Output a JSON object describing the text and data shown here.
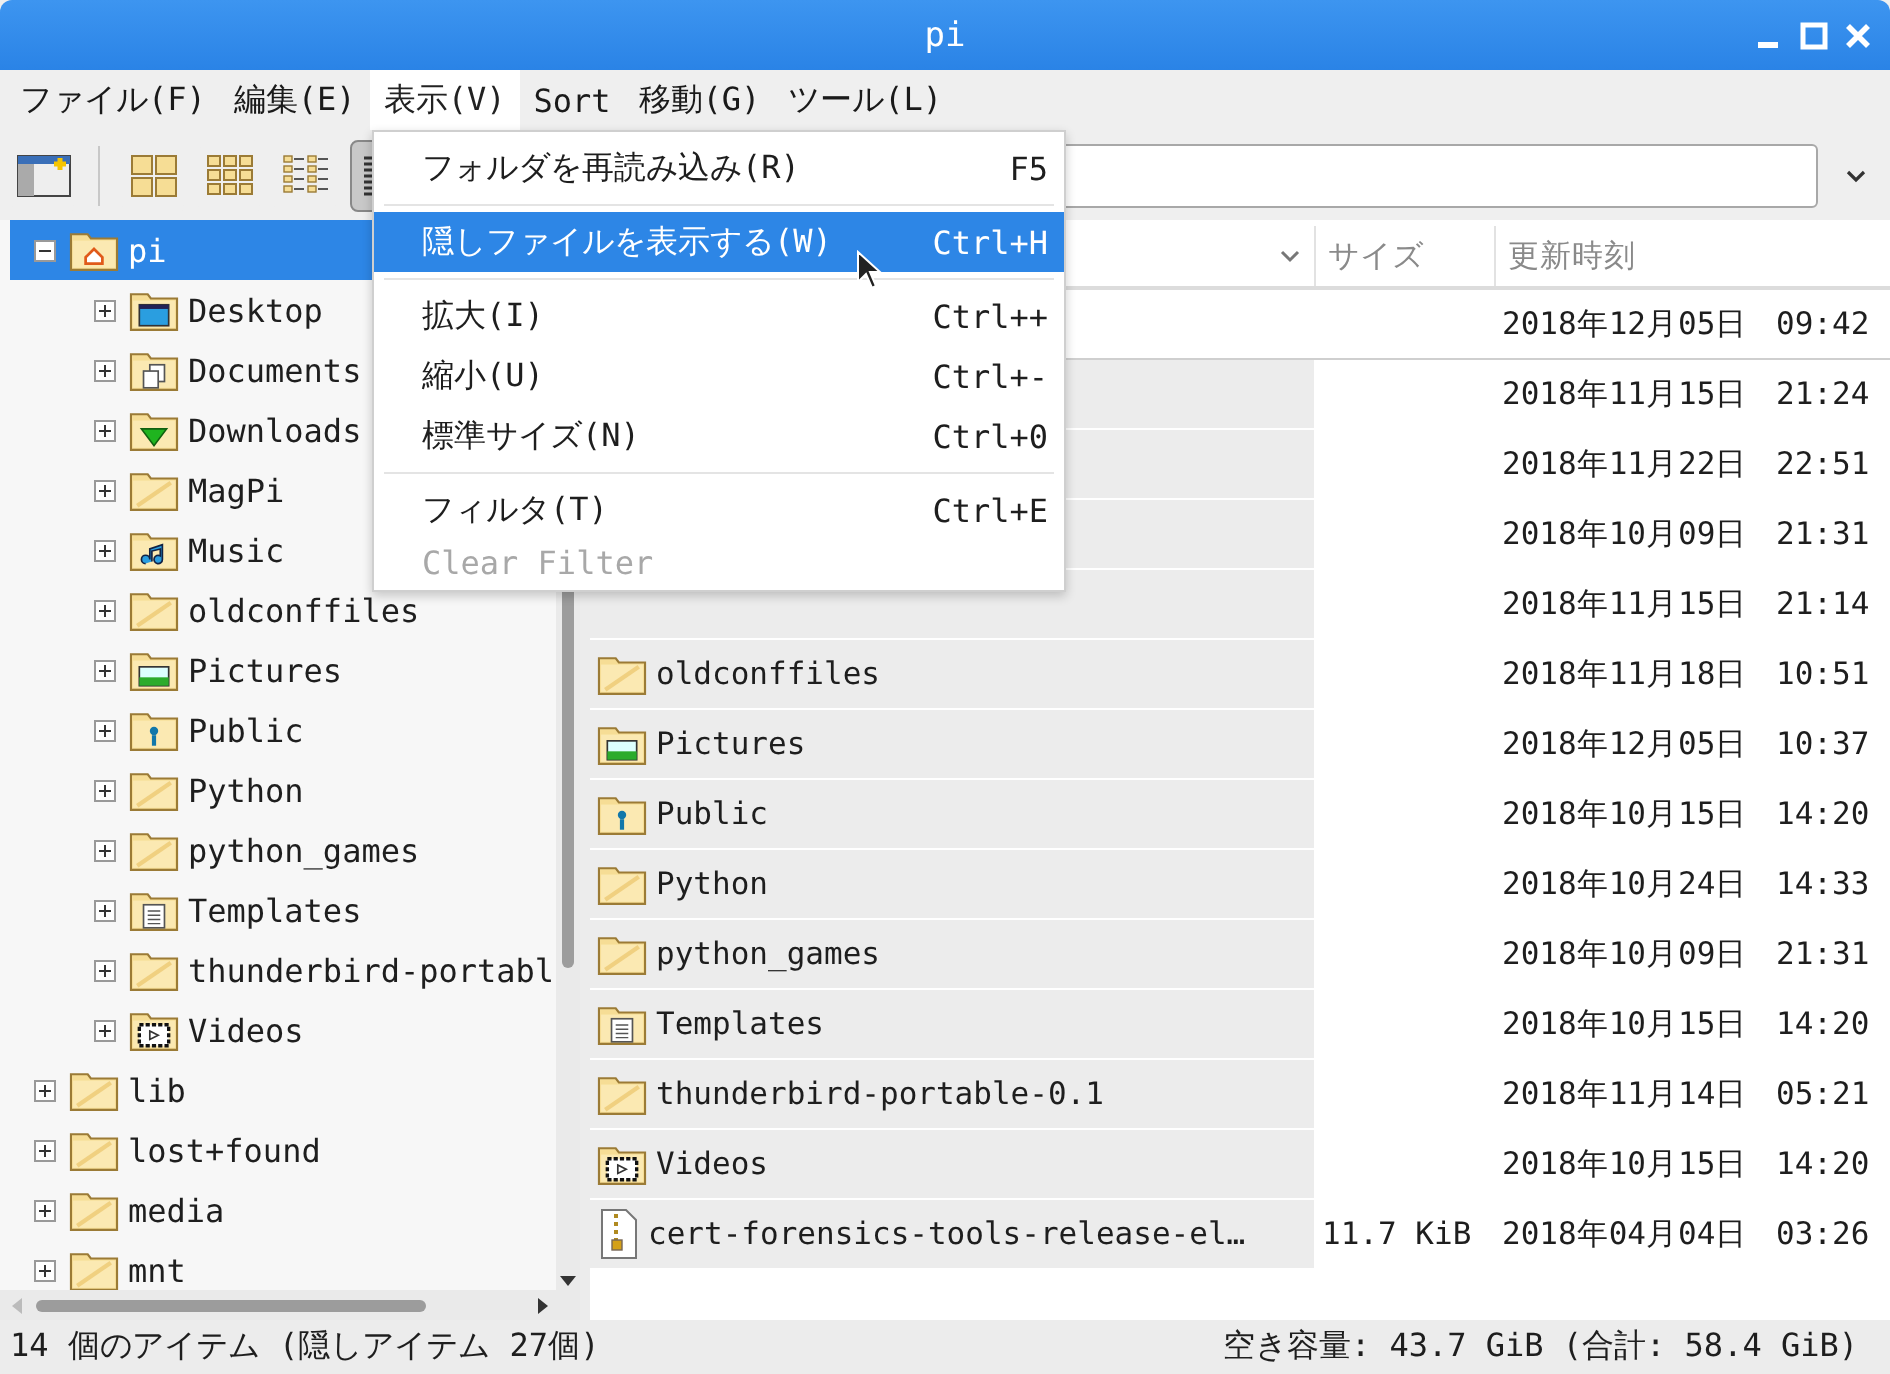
{
  "window": {
    "title": "pi"
  },
  "menubar": [
    {
      "label": "ファイル(F)",
      "selected": false
    },
    {
      "label": "編集(E)",
      "selected": false
    },
    {
      "label": "表示(V)",
      "selected": true
    },
    {
      "label": "Sort",
      "selected": false
    },
    {
      "label": "移動(G)",
      "selected": false
    },
    {
      "label": "ツール(L)",
      "selected": false
    }
  ],
  "toolbar": [
    {
      "kind": "new-tab",
      "selected": false
    },
    {
      "kind": "icons-large",
      "selected": false
    },
    {
      "kind": "icons-small",
      "selected": false
    },
    {
      "kind": "thumbnails",
      "selected": false
    },
    {
      "kind": "details",
      "selected": true
    }
  ],
  "view_menu": [
    {
      "kind": "item",
      "label": "フォルダを再読み込み(R)",
      "shortcut": "F5",
      "selected": false,
      "disabled": false
    },
    {
      "kind": "separator"
    },
    {
      "kind": "item",
      "label": "隠しファイルを表示する(W)",
      "shortcut": "Ctrl+H",
      "selected": true,
      "disabled": false
    },
    {
      "kind": "separator"
    },
    {
      "kind": "item",
      "label": "拡大(I)",
      "shortcut": "Ctrl++",
      "selected": false,
      "disabled": false
    },
    {
      "kind": "item",
      "label": "縮小(U)",
      "shortcut": "Ctrl+-",
      "selected": false,
      "disabled": false
    },
    {
      "kind": "item",
      "label": "標準サイズ(N)",
      "shortcut": "Ctrl+0",
      "selected": false,
      "disabled": false
    },
    {
      "kind": "separator"
    },
    {
      "kind": "item",
      "label": "フィルタ(T)",
      "shortcut": "Ctrl+E",
      "selected": false,
      "disabled": false
    },
    {
      "kind": "item",
      "label": "Clear Filter",
      "selected": false,
      "disabled": true
    }
  ],
  "tree": [
    {
      "label": "pi",
      "kind": "home",
      "expanded": true,
      "selected": true,
      "children": [
        {
          "label": "Desktop",
          "kind": "desktop",
          "expanded": false,
          "selected": false
        },
        {
          "label": "Documents",
          "kind": "documents",
          "expanded": false,
          "selected": false
        },
        {
          "label": "Downloads",
          "kind": "downloads",
          "expanded": false,
          "selected": false
        },
        {
          "label": "MagPi",
          "kind": "folder",
          "expanded": false,
          "selected": false
        },
        {
          "label": "Music",
          "kind": "music",
          "expanded": false,
          "selected": false
        },
        {
          "label": "oldconffiles",
          "kind": "folder",
          "expanded": false,
          "selected": false
        },
        {
          "label": "Pictures",
          "kind": "pictures",
          "expanded": false,
          "selected": false
        },
        {
          "label": "Public",
          "kind": "public",
          "expanded": false,
          "selected": false
        },
        {
          "label": "Python",
          "kind": "folder",
          "expanded": false,
          "selected": false
        },
        {
          "label": "python_games",
          "kind": "folder",
          "expanded": false,
          "selected": false
        },
        {
          "label": "Templates",
          "kind": "templates",
          "expanded": false,
          "selected": false
        },
        {
          "label": "thunderbird-portabl",
          "kind": "folder",
          "expanded": false,
          "selected": false
        },
        {
          "label": "Videos",
          "kind": "videos",
          "expanded": false,
          "selected": false
        }
      ]
    },
    {
      "label": "lib",
      "kind": "folder",
      "expanded": false,
      "selected": false
    },
    {
      "label": "lost+found",
      "kind": "folder",
      "expanded": false,
      "selected": false
    },
    {
      "label": "media",
      "kind": "folder",
      "expanded": false,
      "selected": false
    },
    {
      "label": "mnt",
      "kind": "folder",
      "expanded": false,
      "selected": false
    }
  ],
  "file_list": {
    "columns": [
      {
        "label": "サイズ"
      },
      {
        "label": "更新時刻"
      }
    ],
    "rows": [
      {
        "modified": "2018年12月05日 09:42",
        "focused": true
      },
      {
        "modified": "2018年11月15日 21:24",
        "focused": false
      },
      {
        "modified": "2018年11月22日 22:51",
        "focused": false
      },
      {
        "modified": "2018年10月09日 21:31",
        "focused": false
      },
      {
        "modified": "2018年11月15日 21:14",
        "focused": false
      },
      {
        "name": "oldconffiles",
        "kind": "folder",
        "modified": "2018年11月18日 10:51",
        "focused": false
      },
      {
        "name": "Pictures",
        "kind": "pictures",
        "modified": "2018年12月05日 10:37",
        "focused": false
      },
      {
        "name": "Public",
        "kind": "public",
        "modified": "2018年10月15日 14:20",
        "focused": false
      },
      {
        "name": "Python",
        "kind": "folder",
        "modified": "2018年10月24日 14:33",
        "focused": false
      },
      {
        "name": "python_games",
        "kind": "folder",
        "modified": "2018年10月09日 21:31",
        "focused": false
      },
      {
        "name": "Templates",
        "kind": "templates",
        "modified": "2018年10月15日 14:20",
        "focused": false
      },
      {
        "name": "thunderbird-portable-0.1",
        "kind": "folder",
        "modified": "2018年11月14日 05:21",
        "focused": false
      },
      {
        "name": "Videos",
        "kind": "videos",
        "modified": "2018年10月15日 14:20",
        "focused": false
      },
      {
        "name": "cert-forensics-tools-release-el…",
        "kind": "archive",
        "size": "11.7 KiB",
        "modified": "2018年04月04日 03:26",
        "focused": false
      }
    ]
  },
  "status_bar": {
    "items": "14 個のアイテム (隠しアイテム 27個)",
    "free_space": "空き容量: 43.7 GiB (合計: 58.4 GiB)"
  }
}
